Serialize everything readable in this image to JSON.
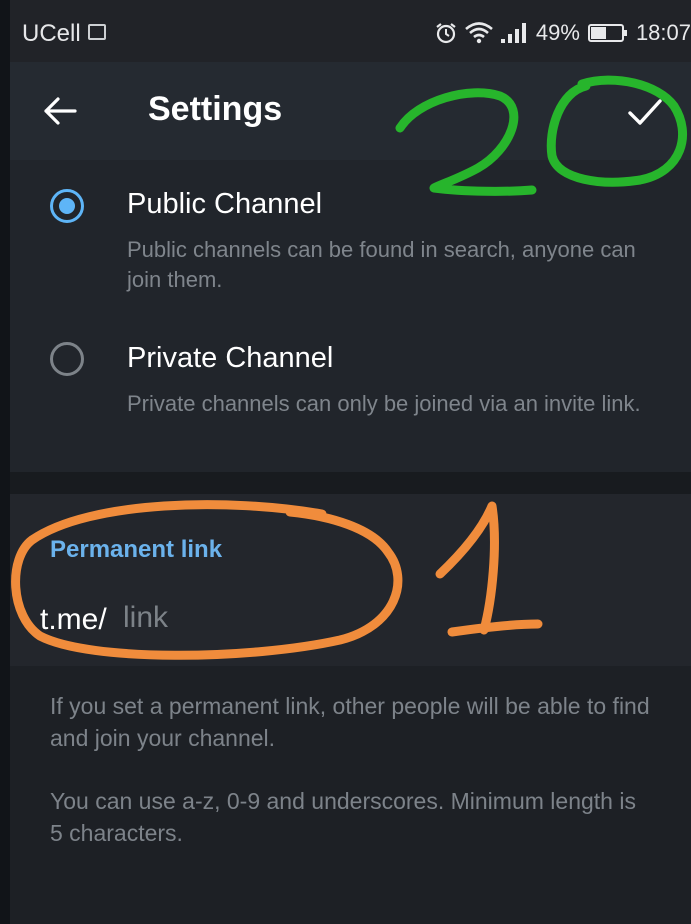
{
  "status_bar": {
    "carrier": "UCell",
    "battery_percent": "49%",
    "battery_level": 0.49,
    "time": "18:07",
    "icons": [
      "gallery-icon",
      "alarm-icon",
      "wifi-icon",
      "signal-icon",
      "battery-icon"
    ]
  },
  "header": {
    "title": "Settings",
    "back_icon": "arrow-left-icon",
    "done_icon": "check-icon"
  },
  "channel_type": {
    "selected": "public",
    "options": [
      {
        "id": "public",
        "title": "Public Channel",
        "description": "Public channels can be found in search, anyone can join them."
      },
      {
        "id": "private",
        "title": "Private Channel",
        "description": "Private channels can only be joined via an invite link."
      }
    ]
  },
  "permanent_link": {
    "header": "Permanent link",
    "prefix": "t.me/",
    "value": "",
    "placeholder": "link"
  },
  "help": {
    "info": "If you set a permanent link, other people will be able to find and join your channel.",
    "rules": "You can use a-z, 0-9 and underscores. Minimum length is 5 characters."
  },
  "annotations": {
    "marks": [
      "1",
      "2"
    ],
    "orange": "#f08c3c",
    "green": "#27b52c"
  },
  "colors": {
    "accent": "#5eb5f7",
    "link_header": "#6bb2ec",
    "background": "#1d2025",
    "muted_text": "#7f858c"
  }
}
